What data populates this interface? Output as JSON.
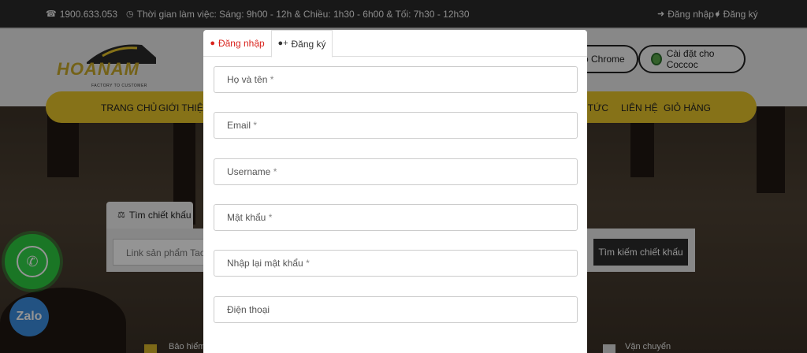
{
  "topbar": {
    "phone": "1900.633.053",
    "hours": "Thời gian làm việc: Sáng: 9h00 - 12h & Chiều: 1h30 - 6h00 & Tối: 7h30 - 12h30",
    "login": "Đăng nhập /",
    "register": "Đăng ký"
  },
  "header": {
    "logo_text": "HOANAM",
    "logo_tagline": "FACTORY TO CUSTOMER",
    "chrome_button": "o Chrome",
    "coccoc_button": "Cài đặt cho Coccoc"
  },
  "nav": {
    "items": [
      "TRANG CHỦ",
      "GIỚI THIỆU",
      "N TỨC",
      "LIÊN HỆ",
      "GIỎ HÀNG"
    ]
  },
  "search": {
    "tab_label": "Tìm chiết khấu",
    "placeholder": "Link sản phẩm Taobao",
    "button": "Tìm kiếm chiết khấu"
  },
  "bottom": {
    "left_text": "Bảo hiểm",
    "right_text": "Vận chuyển"
  },
  "floating": {
    "zalo": "Zalo"
  },
  "modal": {
    "tabs": {
      "login": "Đăng nhập",
      "register": "Đăng ký"
    },
    "fields": [
      {
        "placeholder": "Họ và tên",
        "required": "*"
      },
      {
        "placeholder": "Email",
        "required": "*"
      },
      {
        "placeholder": "Username",
        "required": "*"
      },
      {
        "placeholder": "Mật khẩu",
        "required": "*"
      },
      {
        "placeholder": "Nhập lại mật khẩu",
        "required": "*"
      },
      {
        "placeholder": "Điện thoại",
        "required": ""
      }
    ]
  },
  "colors": {
    "accent_yellow": "#e7c52a",
    "active_tab_red": "#d9231d",
    "topbar": "#2a2a2a"
  }
}
